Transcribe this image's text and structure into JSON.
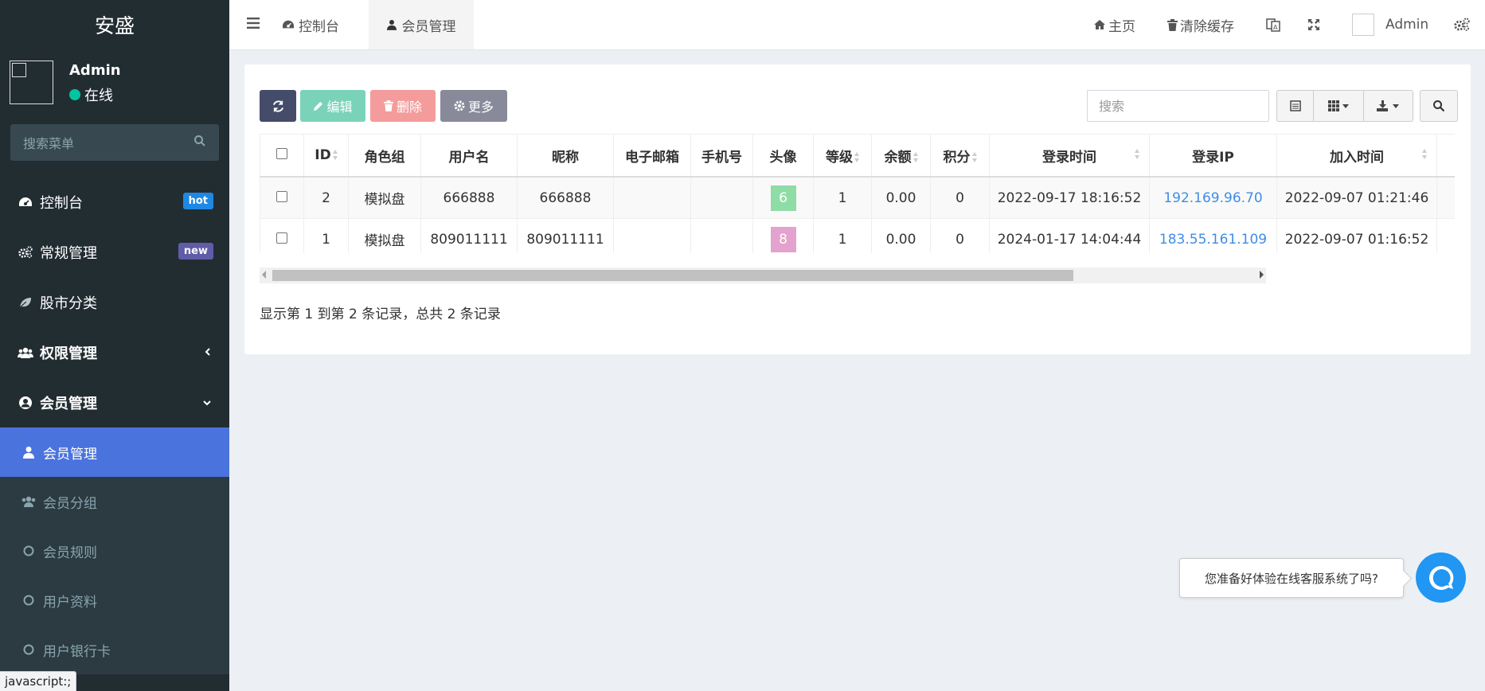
{
  "brand": "安盛",
  "user": {
    "name": "Admin",
    "status": "在线"
  },
  "sidebar_search": {
    "placeholder": "搜索菜单"
  },
  "menu": [
    {
      "label": "控制台",
      "icon": "dashboard-icon",
      "badge": "hot"
    },
    {
      "label": "常规管理",
      "icon": "gears-icon",
      "badge": "new"
    },
    {
      "label": "股市分类",
      "icon": "leaf-icon"
    },
    {
      "label": "权限管理",
      "icon": "users-icon"
    },
    {
      "label": "会员管理",
      "icon": "user-circle-icon"
    }
  ],
  "submenu": [
    {
      "label": "会员管理",
      "icon": "user-icon",
      "active": true
    },
    {
      "label": "会员分组",
      "icon": "users-icon"
    },
    {
      "label": "会员规则",
      "icon": "circle-icon"
    },
    {
      "label": "用户资料",
      "icon": "circle-icon"
    },
    {
      "label": "用户银行卡",
      "icon": "circle-icon"
    }
  ],
  "status_bar": "javascript:;",
  "topnav": {
    "tabs": [
      "控制台",
      "会员管理"
    ],
    "home": "主页",
    "clear_cache": "清除缓存",
    "admin": "Admin"
  },
  "toolbar": {
    "edit": "编辑",
    "delete": "删除",
    "more": "更多",
    "search_placeholder": "搜索"
  },
  "table": {
    "columns": [
      "ID",
      "角色组",
      "用户名",
      "昵称",
      "电子邮箱",
      "手机号",
      "头像",
      "等级",
      "余额",
      "积分",
      "登录时间",
      "登录IP",
      "加入时间"
    ],
    "rows": [
      {
        "id": "2",
        "group": "模拟盘",
        "username": "666888",
        "nickname": "666888",
        "email": "",
        "phone": "",
        "avatar": "6",
        "avatar_color": "#8fdca7",
        "level": "1",
        "balance": "0.00",
        "score": "0",
        "login_time": "2022-09-17 18:16:52",
        "login_ip": "192.169.96.70",
        "join_time": "2022-09-07 01:21:46"
      },
      {
        "id": "1",
        "group": "模拟盘",
        "username": "809011111",
        "nickname": "809011111",
        "email": "",
        "phone": "",
        "avatar": "8",
        "avatar_color": "#e4a2cf",
        "level": "1",
        "balance": "0.00",
        "score": "0",
        "login_time": "2024-01-17 14:04:44",
        "login_ip": "183.55.161.109",
        "join_time": "2022-09-07 01:16:52"
      }
    ]
  },
  "pagination_info": "显示第 1 到第 2 条记录，总共 2 条记录",
  "chat": {
    "prompt": "您准备好体验在线客服系统了吗?"
  }
}
